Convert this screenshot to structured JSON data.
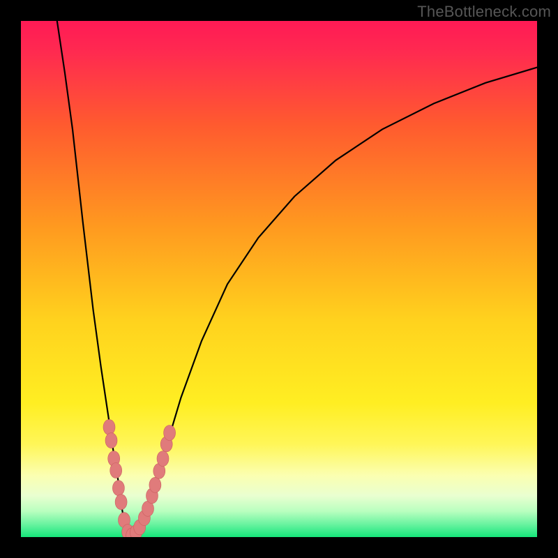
{
  "watermark": "TheBottleneck.com",
  "colors": {
    "bg_black": "#000000",
    "grad_top": "#ff1a55",
    "grad_mid1": "#ff5a2f",
    "grad_mid2": "#ffbf1f",
    "grad_yellow": "#ffee22",
    "grad_pale": "#fbffb0",
    "grad_green": "#15e67a",
    "curve": "#000000",
    "marker_fill": "#e07b7b",
    "marker_stroke": "#c95f5f"
  },
  "chart_data": {
    "type": "line",
    "title": "",
    "xlabel": "",
    "ylabel": "",
    "xlim": [
      0,
      100
    ],
    "ylim": [
      0,
      100
    ],
    "series": [
      {
        "name": "curve",
        "x": [
          7,
          8.5,
          10,
          12,
          14,
          15.5,
          17,
          18,
          19,
          19.5,
          20,
          20.5,
          21,
          21.5,
          22,
          23,
          24,
          26,
          28,
          31,
          35,
          40,
          46,
          53,
          61,
          70,
          80,
          90,
          100
        ],
        "y": [
          100,
          90,
          79,
          61,
          44,
          33,
          23,
          16,
          10,
          6,
          3,
          1.5,
          0.5,
          0.3,
          0.5,
          1.8,
          4,
          10,
          17,
          27,
          38,
          49,
          58,
          66,
          73,
          79,
          84,
          88,
          91
        ]
      }
    ],
    "markers": [
      {
        "x": 17.1,
        "y": 21.3
      },
      {
        "x": 17.5,
        "y": 18.7
      },
      {
        "x": 18.0,
        "y": 15.2
      },
      {
        "x": 18.4,
        "y": 12.9
      },
      {
        "x": 18.9,
        "y": 9.5
      },
      {
        "x": 19.4,
        "y": 6.8
      },
      {
        "x": 20.0,
        "y": 3.3
      },
      {
        "x": 20.7,
        "y": 1.0
      },
      {
        "x": 21.5,
        "y": 0.3
      },
      {
        "x": 22.3,
        "y": 0.9
      },
      {
        "x": 23.0,
        "y": 1.9
      },
      {
        "x": 23.9,
        "y": 3.7
      },
      {
        "x": 24.6,
        "y": 5.5
      },
      {
        "x": 25.4,
        "y": 8.0
      },
      {
        "x": 26.0,
        "y": 10.1
      },
      {
        "x": 26.8,
        "y": 12.8
      },
      {
        "x": 27.5,
        "y": 15.2
      },
      {
        "x": 28.2,
        "y": 18.0
      },
      {
        "x": 28.8,
        "y": 20.2
      }
    ]
  }
}
